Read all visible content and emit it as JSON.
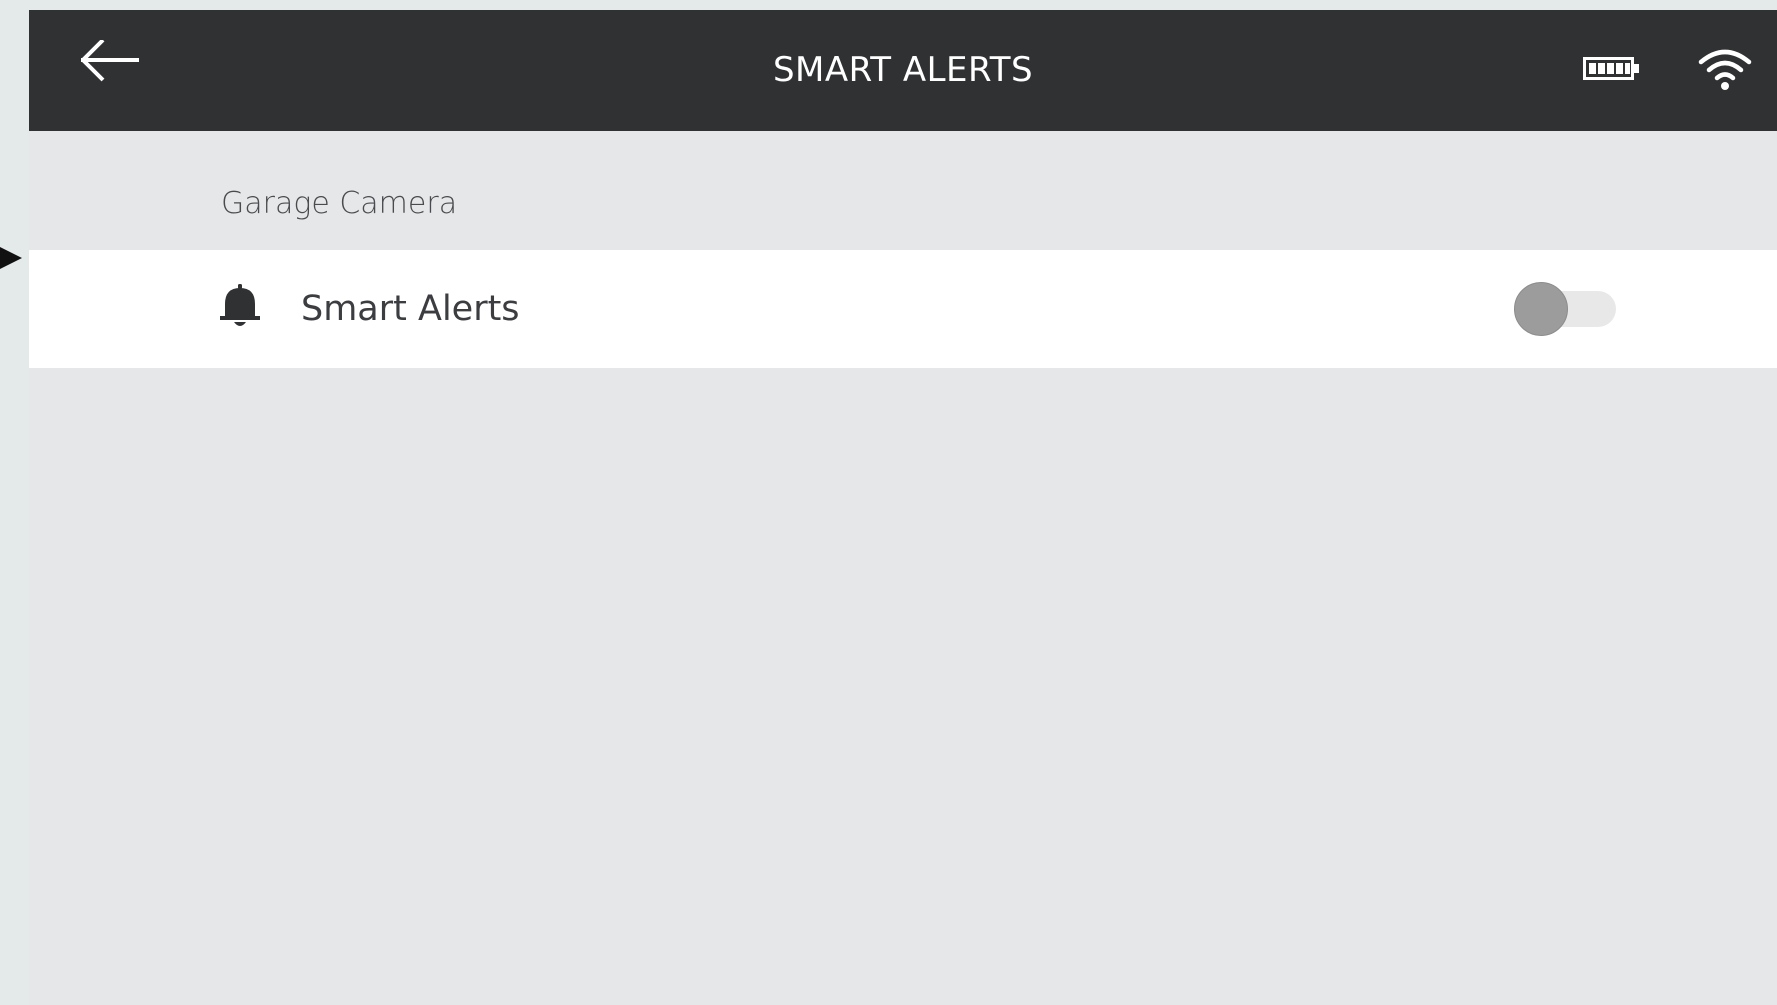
{
  "header": {
    "title": "SMART ALERTS",
    "back_icon": "arrow-left-icon",
    "battery_icon": "battery-icon",
    "wifi_icon": "wifi-icon"
  },
  "section": {
    "label": "Garage Camera"
  },
  "smart_alerts_row": {
    "icon": "bell-icon",
    "label": "Smart Alerts",
    "toggle_on": false
  },
  "colors": {
    "header_bg": "#303133",
    "page_bg": "#e6e7e9",
    "row_bg": "#ffffff",
    "toggle_knob_off": "#9c9c9c"
  }
}
